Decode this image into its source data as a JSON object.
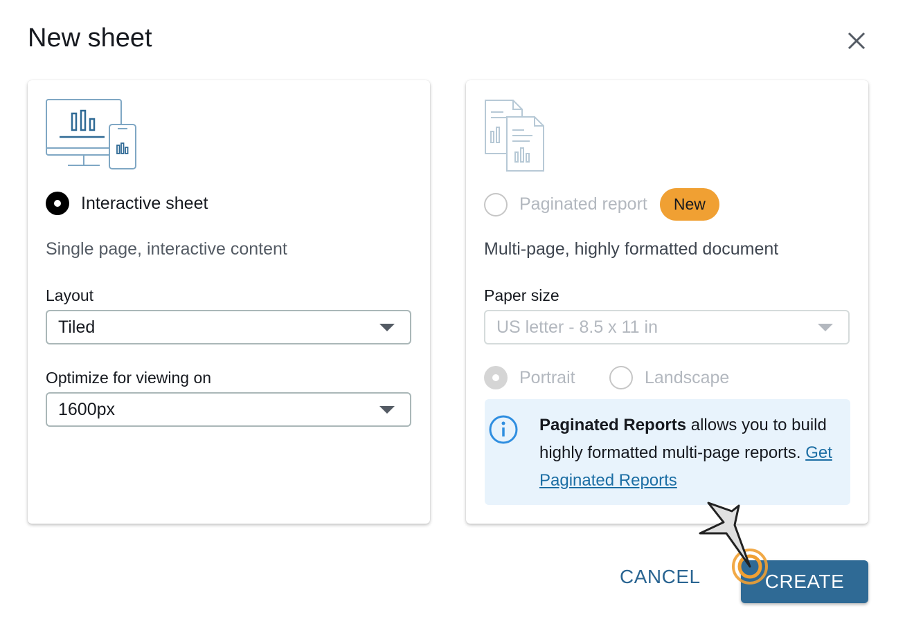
{
  "dialog": {
    "title": "New sheet"
  },
  "interactive": {
    "option_label": "Interactive sheet",
    "description": "Single page, interactive content",
    "layout_label": "Layout",
    "layout_value": "Tiled",
    "optimize_label": "Optimize for viewing on",
    "optimize_value": "1600px"
  },
  "paginated": {
    "option_label": "Paginated report",
    "badge": "New",
    "description": "Multi-page, highly formatted document",
    "paper_label": "Paper size",
    "paper_value": "US letter - 8.5 x 11 in",
    "portrait_label": "Portrait",
    "landscape_label": "Landscape",
    "info_bold": "Paginated Reports",
    "info_text": " allows you to build highly formatted multi-page reports. ",
    "info_link": "Get Paginated Reports"
  },
  "footer": {
    "cancel_label": "CANCEL",
    "create_label": "CREATE"
  },
  "colors": {
    "primary": "#2f6a95",
    "badge": "#f0a033",
    "info_bg": "#e8f3fc",
    "link": "#1c6ea4"
  }
}
